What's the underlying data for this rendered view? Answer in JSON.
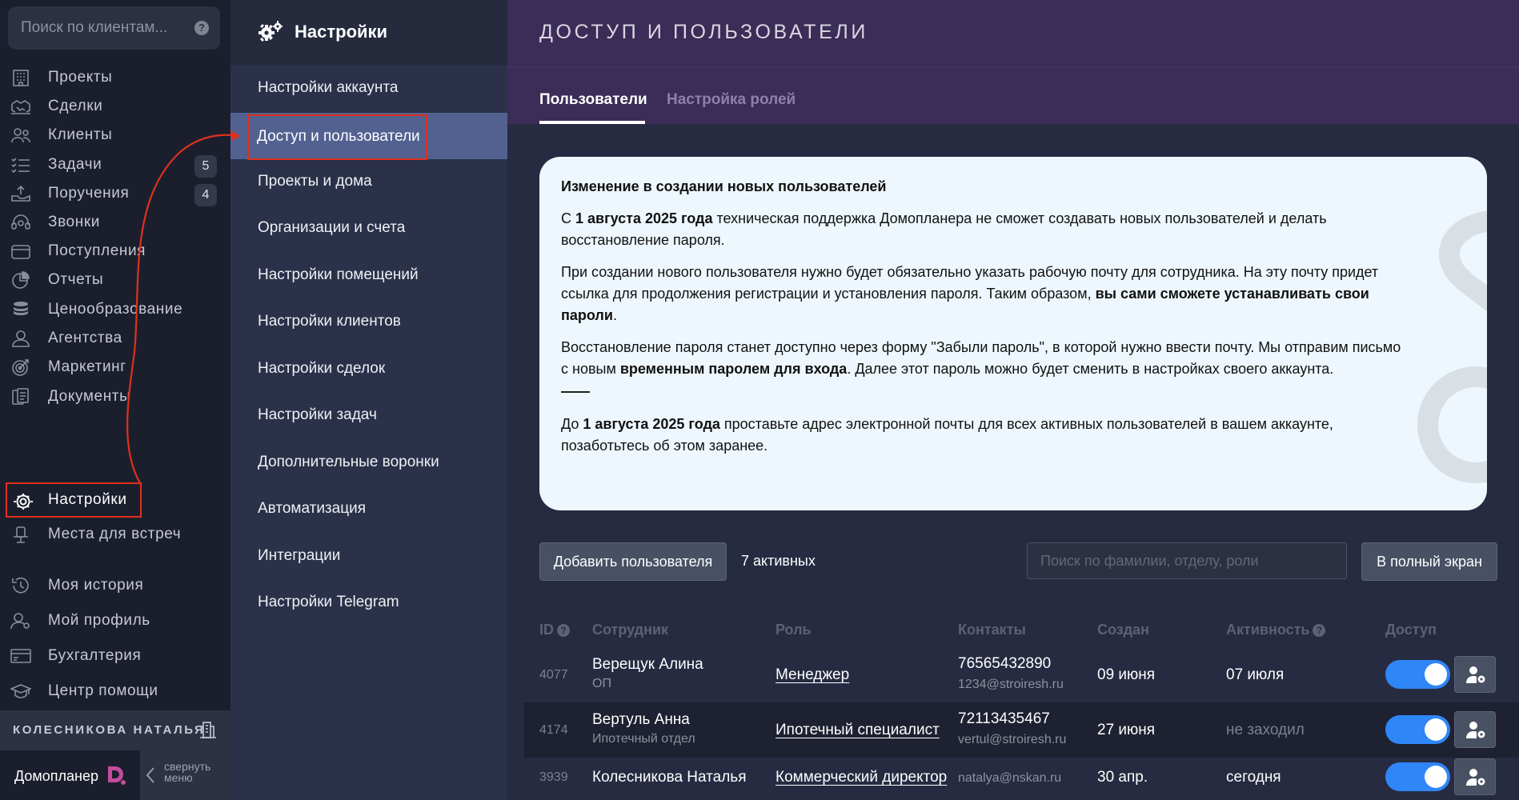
{
  "sidebar": {
    "search": {
      "placeholder": "Поиск по клиентам..."
    },
    "items": [
      {
        "label": "Проекты",
        "icon": "building-grid-icon"
      },
      {
        "label": "Сделки",
        "icon": "handshake-icon"
      },
      {
        "label": "Клиенты",
        "icon": "people-icon"
      },
      {
        "label": "Задачи",
        "icon": "checklist-icon",
        "badge": "5"
      },
      {
        "label": "Поручения",
        "icon": "hand-up-icon",
        "badge": "4"
      },
      {
        "label": "Звонки",
        "icon": "headset-icon"
      },
      {
        "label": "Поступления",
        "icon": "wallet-icon"
      },
      {
        "label": "Отчеты",
        "icon": "pie-chart-icon"
      },
      {
        "label": "Ценообразование",
        "icon": "coins-icon"
      },
      {
        "label": "Агентства",
        "icon": "agent-icon"
      },
      {
        "label": "Маркетинг",
        "icon": "target-icon"
      },
      {
        "label": "Документы",
        "icon": "documents-icon"
      },
      {
        "label": "Настройки",
        "icon": "gear-icon"
      },
      {
        "label": "Места для встреч",
        "icon": "meeting-icon"
      },
      {
        "label": "Моя история",
        "icon": "history-icon"
      },
      {
        "label": "Мой профиль",
        "icon": "profile-icon"
      },
      {
        "label": "Бухгалтерия",
        "icon": "accounting-icon"
      },
      {
        "label": "Центр помощи",
        "icon": "graduation-cap-icon"
      }
    ],
    "user_name": "КОЛЕСНИКОВА НАТАЛЬЯ",
    "brand": "Домопланер",
    "collapse_label": "свернуть меню"
  },
  "settings_nav": {
    "title": "Настройки",
    "items": [
      "Настройки аккаунта",
      "Доступ и пользователи",
      "Проекты и дома",
      "Организации и счета",
      "Настройки помещений",
      "Настройки клиентов",
      "Настройки сделок",
      "Настройки задач",
      "Дополнительные воронки",
      "Автоматизация",
      "Интеграции",
      "Настройки Telegram"
    ],
    "active_index": 1
  },
  "main": {
    "title": "ДОСТУП И ПОЛЬЗОВАТЕЛИ",
    "tabs": [
      {
        "label": "Пользователи",
        "active": true
      },
      {
        "label": "Настройка ролей",
        "active": false
      }
    ],
    "notice": {
      "heading": "Изменение в создании новых пользователей",
      "p1_pre": "С ",
      "p1_bold": "1 августа 2025 года",
      "p1_post": " техническая поддержка Домопланера не сможет создавать новых пользователей и делать восстановление пароля.",
      "p2_pre": "При создании нового пользователя нужно будет обязательно указать рабочую почту для сотрудника. На эту почту придет ссылка для продолжения регистрации и установления пароля. Таким образом, ",
      "p2_bold": "вы сами сможете устанавливать свои пароли",
      "p2_post": ".",
      "p3_pre": "Восстановление пароля станет доступно через форму \"Забыли пароль\", в которой нужно ввести почту. Мы отправим письмо с новым ",
      "p3_bold": "временным паролем для входа",
      "p3_post": ". Далее этот пароль можно будет сменить в настройках своего аккаунта.",
      "p4_pre": "До ",
      "p4_bold": "1 августа 2025 года",
      "p4_post": " проставьте адрес электронной почты для всех активных пользователей в вашем аккаунте, позаботьтесь об этом заранее."
    },
    "toolbar": {
      "add_user_label": "Добавить пользователя",
      "active_count": "7 активных",
      "search_placeholder": "Поиск по фамилии, отделу, роли",
      "fullscreen_label": "В полный экран"
    },
    "table": {
      "headers": {
        "id": "ID",
        "employee": "Сотрудник",
        "role": "Роль",
        "contacts": "Контакты",
        "created": "Создан",
        "activity": "Активность",
        "access": "Доступ"
      },
      "rows": [
        {
          "id": "4077",
          "name": "Верещук Алина",
          "dept": "ОП",
          "role": "Менеджер",
          "phone": "76565432890",
          "email": "1234@stroiresh.ru",
          "created": "09 июня",
          "activity": "07 июля",
          "access": true
        },
        {
          "id": "4174",
          "name": "Вертуль Анна",
          "dept": "Ипотечный отдел",
          "role": "Ипотечный специалист",
          "phone": "72113435467",
          "email": "vertul@stroiresh.ru",
          "created": "27 июня",
          "activity": "не заходил",
          "access": true
        },
        {
          "id": "3939",
          "name": "Колесникова Наталья",
          "dept": "",
          "role": "Коммерческий директор",
          "phone": "",
          "email": "natalya@nskan.ru",
          "created": "30 апр.",
          "activity": "сегодня",
          "access": true
        }
      ]
    }
  },
  "colors": {
    "accent_blue": "#2f86f6",
    "highlight_red": "#e0301e",
    "header_purple": "#3b2d57",
    "active_nav": "#536191"
  }
}
